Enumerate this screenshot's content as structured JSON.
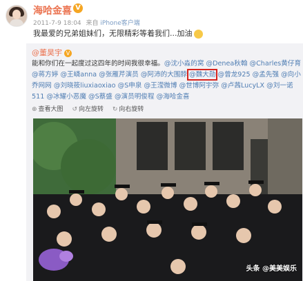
{
  "post": {
    "author": "海哈金喜",
    "verified_badge": "V",
    "timestamp": "2011-7-9 18:04",
    "client_prefix": "来自",
    "client": "iPhone客户端",
    "text": "我最爱的兄弟姐妹们，无限精彩等着我们...加油"
  },
  "repost": {
    "author": "@董昊宇",
    "verified_badge": "V",
    "intro": "能和你们在一起度过这四年的时间我很幸福。",
    "mentions": [
      "@沈小淼的窝",
      "@Denea秋翰",
      "@Charles黄仔育",
      "@蒋方婷",
      "@王嶙anna",
      "@张雁芹演员",
      "@阿沛的大围脖",
      "@魏大勋",
      "@曾龙925",
      "@孟先强",
      "@向小乔网网",
      "@刘晓筱liuxiaoxiao",
      "@S申泉",
      "@王滢微博",
      "@世博阿宇弥",
      "@卢茜LucyLX",
      "@刘一诺511",
      "@冰耀小恶魔",
      "@S蔡盛",
      "@演员明俊程",
      "@海哈金喜"
    ],
    "highlighted_mention": "@魏大勋"
  },
  "actions": [
    {
      "icon": "view-large-icon",
      "glyph": "⊕",
      "label": "查看大图"
    },
    {
      "icon": "rotate-left-icon",
      "glyph": "↺",
      "label": "向左旋转"
    },
    {
      "icon": "rotate-right-icon",
      "glyph": "↻",
      "label": "向右旋转"
    }
  ],
  "watermark": "头条 @美美娱乐"
}
